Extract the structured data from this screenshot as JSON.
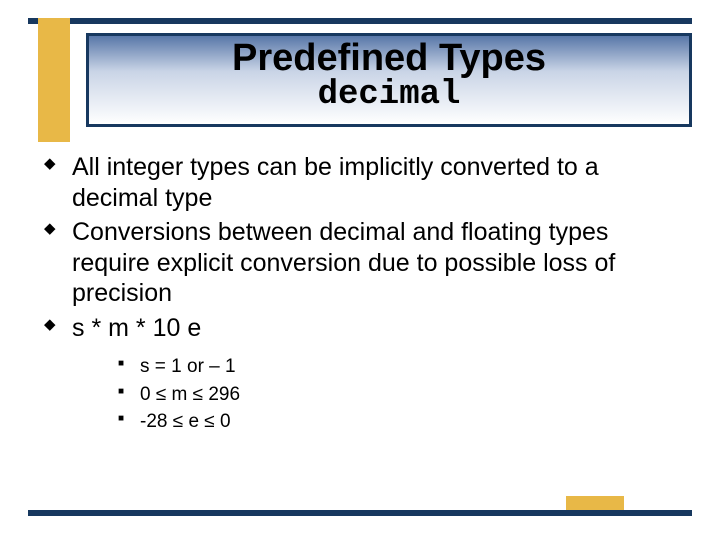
{
  "title": {
    "main": "Predefined Types",
    "sub": "decimal"
  },
  "bullets": [
    "All integer types can be implicitly converted to a decimal type",
    "Conversions between decimal and floating types require explicit conversion due to possible loss of precision",
    "s * m * 10 e"
  ],
  "subbullets": [
    "s = 1 or – 1",
    "0 ≤ m ≤ 296",
    "-28 ≤ e ≤ 0"
  ],
  "colors": {
    "navy": "#17385f",
    "gold": "#e8b847"
  }
}
